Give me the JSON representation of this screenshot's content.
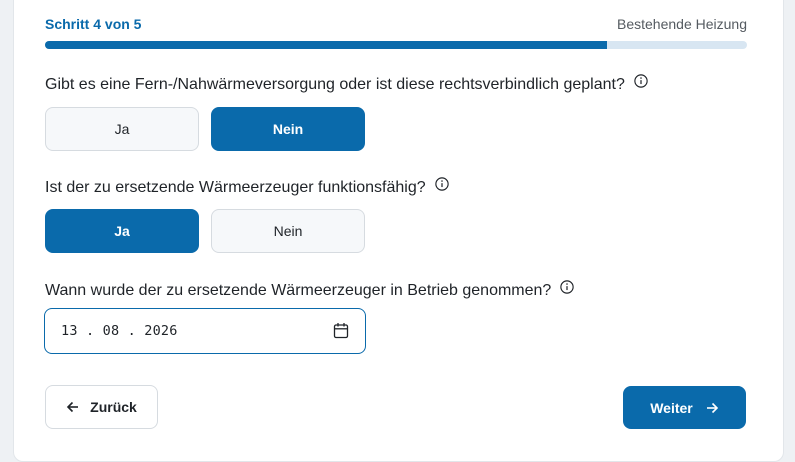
{
  "header": {
    "step_label": "Schritt 4 von 5",
    "step_name": "Bestehende Heizung",
    "progress_fraction": 0.8
  },
  "questions": [
    {
      "text": "Gibt es eine Fern-/Nahwärmeversorgung oder ist diese rechtsverbindlich geplant?",
      "options": [
        "Ja",
        "Nein"
      ],
      "selected": "Nein"
    },
    {
      "text": "Ist der zu ersetzende Wärmeerzeuger funktionsfähig?",
      "options": [
        "Ja",
        "Nein"
      ],
      "selected": "Ja"
    },
    {
      "text": "Wann wurde der zu ersetzende Wärmeerzeuger in Betrieb genommen?",
      "date_value": "13.08.2026"
    }
  ],
  "footer": {
    "back_label": "Zurück",
    "next_label": "Weiter"
  },
  "colors": {
    "accent": "#0a6aab",
    "progress_track": "#d8e6f2"
  }
}
